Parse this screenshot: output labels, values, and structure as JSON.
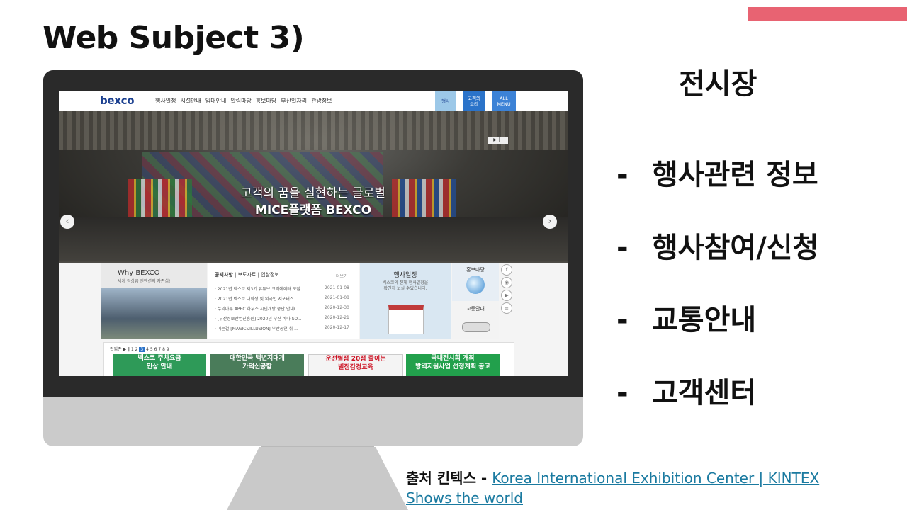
{
  "slide": {
    "title": "Web Subject 3)",
    "accent_color": "#e86372"
  },
  "monitor_screen": {
    "logo": "bexco",
    "menu": [
      "행사일정",
      "시설안내",
      "임대안내",
      "알림마당",
      "홍보마당",
      "부산일자리",
      "관광정보"
    ],
    "quick_buttons": [
      "행사",
      "고객의\n소리",
      "ALL\nMENU"
    ],
    "hero_line1": "고객의 꿈을 실현하는 글로벌",
    "hero_line2": "MICE플랫폼  BEXCO",
    "why_title": "Why BEXCO",
    "why_sub": "세계 정상급 컨벤션의 자존심!",
    "notice_tabs": [
      "공지사항",
      "보도자료",
      "입찰정보"
    ],
    "notice_more": "더보기",
    "notices": [
      {
        "text": "2021년 벡스코 제3기 유튜브 크리에이터 모집",
        "date": "2021-01-08"
      },
      {
        "text": "2021년 벡스코 대학생 및 외국인 서포터즈 ...",
        "date": "2021-01-08"
      },
      {
        "text": "누리마루 APEC 하우스 시민개방 중단 안내(...",
        "date": "2020-12-30"
      },
      {
        "text": "[부산정보산업진흥원] 2020년 부산 바다 SO...",
        "date": "2020-12-21"
      },
      {
        "text": "이은결 [MAGIC&ILLUSION] 부산공연 취 ...",
        "date": "2020-12-17"
      }
    ],
    "schedule_title": "행사일정",
    "schedule_sub": "벡스코의 전체 행사일정을\n확인해 보실 수있습니다.",
    "promo_title": "홍보마당",
    "traffic_title": "교통안내",
    "pager_label": "팝업존",
    "pager_pages": [
      "1",
      "2",
      "3",
      "4",
      "5",
      "6",
      "7",
      "8",
      "9"
    ],
    "banners": [
      "벡스코 주차요금\n인상 안내",
      "대한민국 백년지대계\n가덕신공항",
      "운전별점 20점 줄이는\n벌점감경교육",
      "국내전시회 개최\n방역지원사업 선정계획 공고"
    ]
  },
  "right_panel": {
    "heading": "전시장",
    "items": [
      "행사관련 정보",
      "행사참여/신청",
      "교통안내",
      "고객센터"
    ],
    "bullet": "-"
  },
  "source": {
    "label": "출처 킨텍스 - ",
    "link_text": "Korea International Exhibition Center | KINTEX Shows the world"
  }
}
